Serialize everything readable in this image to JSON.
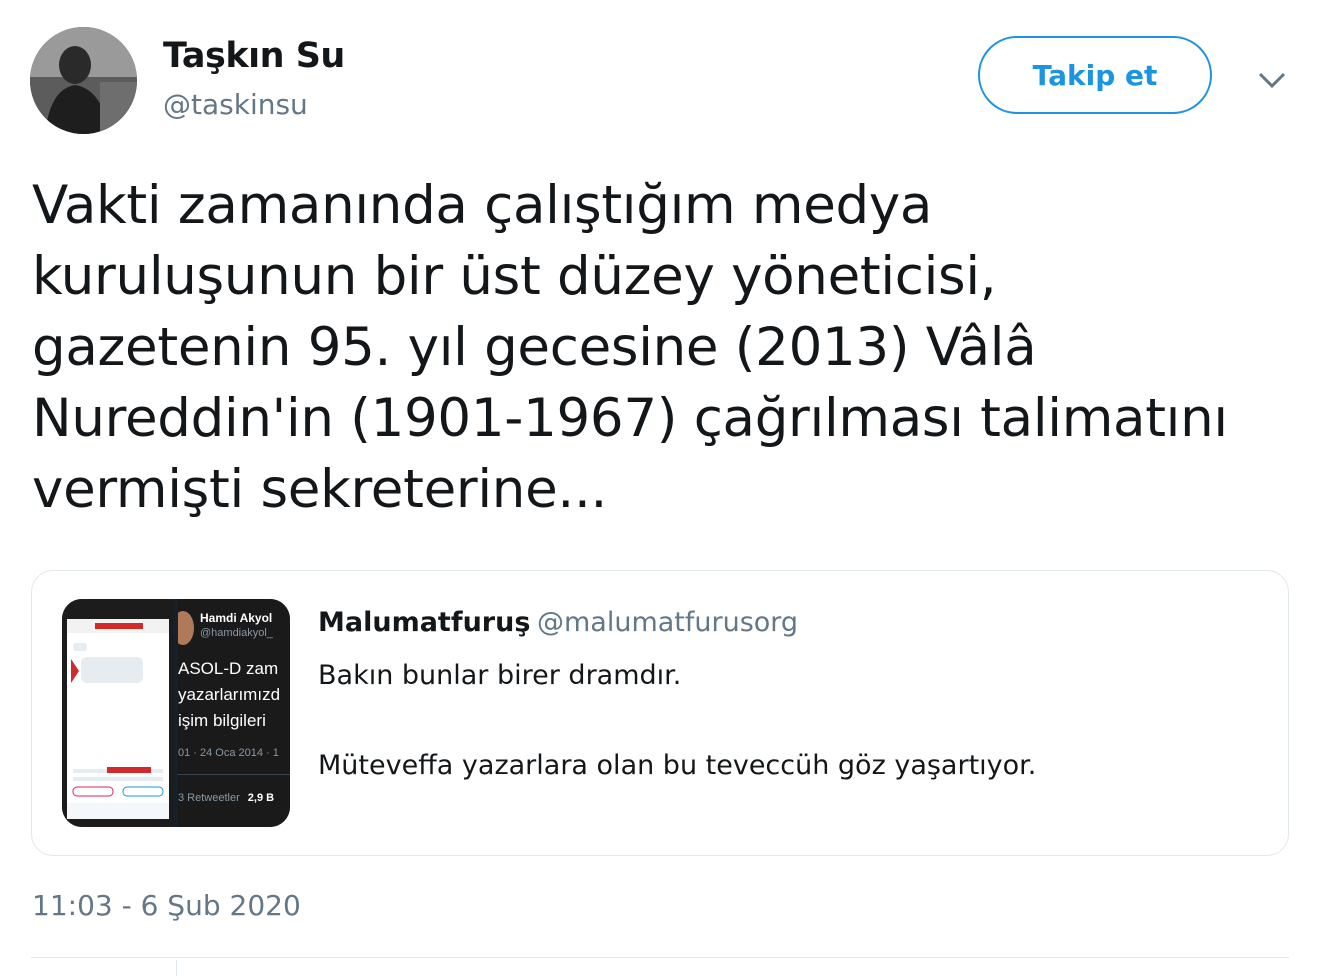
{
  "author": {
    "name": "Taşkın Su",
    "handle": "@taskinsu"
  },
  "actions": {
    "follow_label": "Takip et",
    "menu_icon": "chevron-down-icon"
  },
  "tweet": {
    "lines": [
      "Vakti zamanında çalıştığım medya",
      "kuruluşunun bir üst düzey yöneticisi,",
      "gazetenin 95. yıl gecesine (2013) Vâlâ",
      "Nureddin'in (1901-1967) çağrılması talimatını",
      "vermişti sekreterine..."
    ],
    "timestamp": "11:03 - 6 Şub 2020"
  },
  "quoted_tweet": {
    "name": "Malumatfuruş",
    "handle": "@malumatfurusorg",
    "body": [
      "Bakın bunlar birer dramdır.",
      "Müteveffa yazarlara olan bu teveccüh göz yaşartıyor."
    ],
    "media_preview": {
      "name": "Hamdi Akyol",
      "handle": "@hamdiakyol_",
      "lines": [
        "ASOL-D zam",
        "yazarlarımızd",
        "işim bilgileri"
      ],
      "meta": "01 · 24 Oca 2014 · 1",
      "stats_label": "3 Retweetler",
      "stats_value": "2,9 B"
    }
  },
  "colors": {
    "accent": "#1b95e0",
    "muted": "#657786",
    "text": "#14171a",
    "border": "#e1e8ed"
  }
}
